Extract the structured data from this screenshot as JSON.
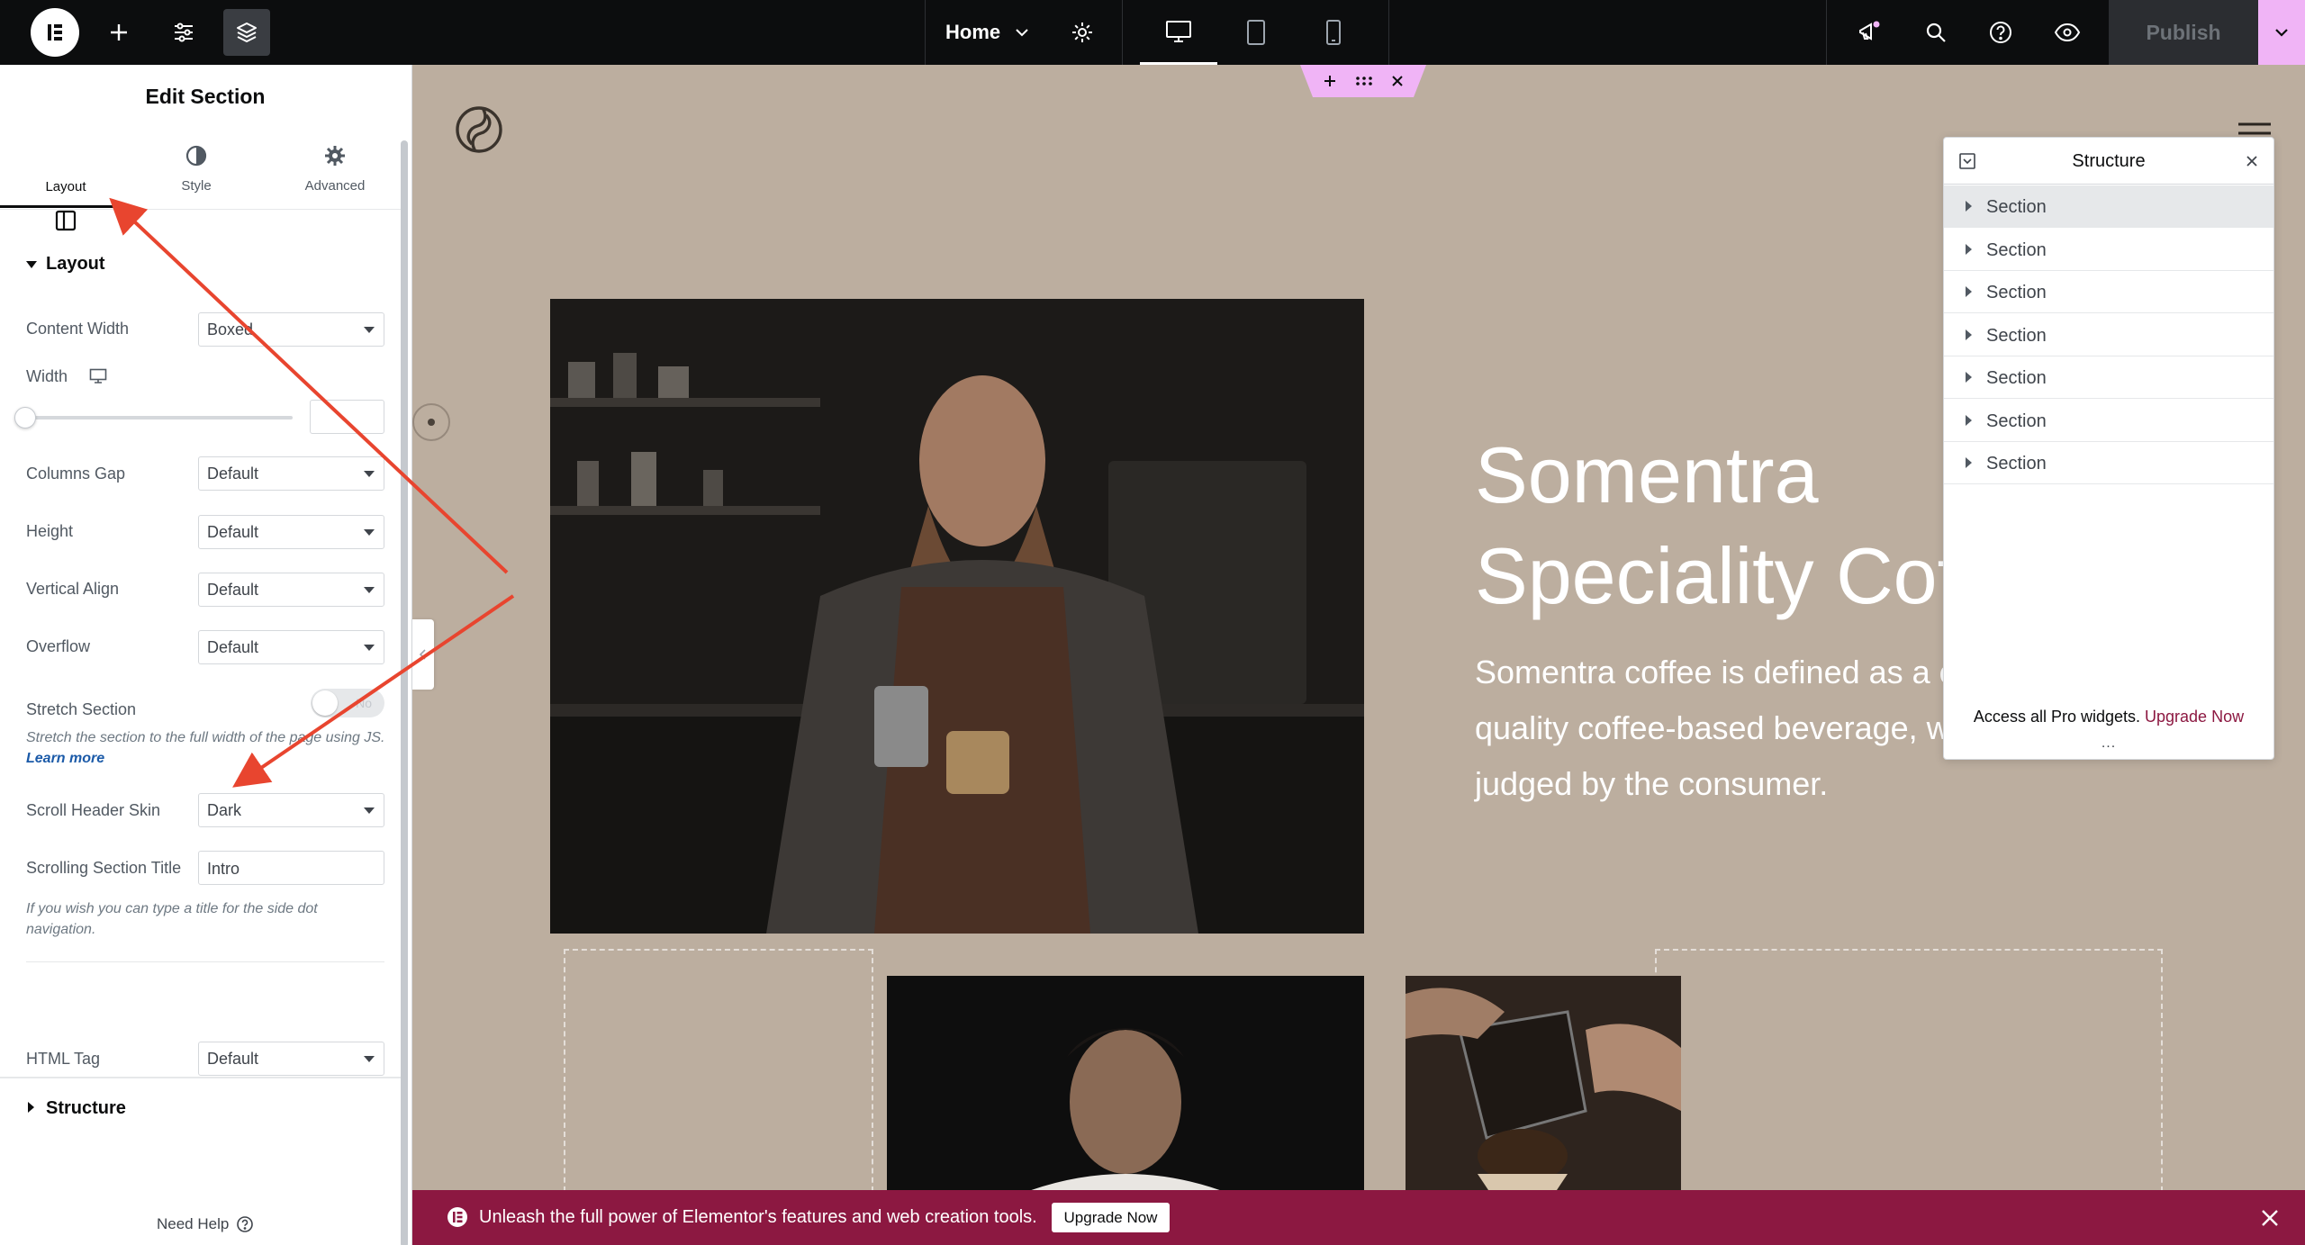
{
  "topbar": {
    "page_name": "Home",
    "publish_label": "Publish"
  },
  "panel": {
    "title": "Edit Section",
    "tabs": [
      {
        "label": "Layout",
        "active": true
      },
      {
        "label": "Style",
        "active": false
      },
      {
        "label": "Advanced",
        "active": false
      }
    ],
    "layout_section_title": "Layout",
    "fields": {
      "content_width": {
        "label": "Content Width",
        "value": "Boxed"
      },
      "width": {
        "label": "Width",
        "value": ""
      },
      "columns_gap": {
        "label": "Columns Gap",
        "value": "Default"
      },
      "height": {
        "label": "Height",
        "value": "Default"
      },
      "vertical_align": {
        "label": "Vertical Align",
        "value": "Default"
      },
      "overflow": {
        "label": "Overflow",
        "value": "Default"
      },
      "stretch_section": {
        "label": "Stretch Section",
        "toggle_text": "No",
        "on": false
      },
      "stretch_help": "Stretch the section to the full width of the page using JS.",
      "learn_more": "Learn more",
      "scroll_header_skin": {
        "label": "Scroll Header Skin",
        "value": "Dark"
      },
      "scrolling_section_title": {
        "label": "Scrolling Section Title",
        "value": "Intro"
      },
      "scrolling_help": "If you wish you can type a title for the side dot navigation.",
      "html_tag": {
        "label": "HTML Tag",
        "value": "Default"
      }
    },
    "structure_section_title": "Structure",
    "need_help": "Need Help"
  },
  "canvas": {
    "hero_title_line1": "Somentra",
    "hero_title_line2": "Speciality Cof",
    "hero_text_line1": "Somentra coffee is defined as a c",
    "hero_text_line2": "quality coffee-based beverage, wh",
    "hero_text_line3": "judged by the consumer."
  },
  "structure_panel": {
    "title": "Structure",
    "items": [
      "Section",
      "Section",
      "Section",
      "Section",
      "Section",
      "Section",
      "Section"
    ],
    "footer_text": "Access all Pro widgets.",
    "footer_link": "Upgrade Now",
    "more": "..."
  },
  "banner": {
    "text": "Unleash the full power of Elementor's features and web creation tools.",
    "button": "Upgrade Now"
  },
  "colors": {
    "canvas_bg": "#bcae9f",
    "accent_pink": "#f0b4f6",
    "banner_bg": "#8c1841",
    "annotation_arrow": "#e8452f"
  }
}
